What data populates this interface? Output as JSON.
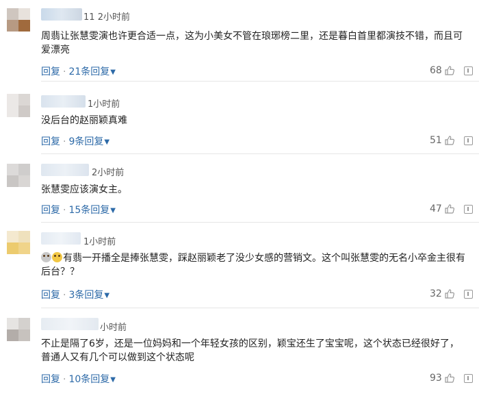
{
  "comments": [
    {
      "time": "2小时前",
      "name_suffix": "11",
      "text": "周翡让张慧雯演也许更合适一点，这为小美女不管在琅琊榜二里，还是暮白首里都演技不错，而且可爱漂亮",
      "reply_label": "回复",
      "replies_label": "21条回复",
      "likes": "68"
    },
    {
      "time": "1小时前",
      "name_suffix": "",
      "text": "没后台的赵丽颖真难",
      "reply_label": "回复",
      "replies_label": "9条回复",
      "likes": "51"
    },
    {
      "time": "2小时前",
      "name_suffix": "",
      "text": "张慧雯应该演女主。",
      "reply_label": "回复",
      "replies_label": "15条回复",
      "likes": "47"
    },
    {
      "time": "1小时前",
      "name_suffix": "",
      "text": "有翡一开播全是捧张慧雯，踩赵丽颖老了没少女感的营销文。这个叫张慧雯的无名小卒金主很有后台？？",
      "reply_label": "回复",
      "replies_label": "3条回复",
      "likes": "32"
    },
    {
      "time": "小时前",
      "name_suffix": "",
      "text": "不止是隔了6岁，还是一位妈妈和一个年轻女孩的区别，颖宝还生了宝宝呢，这个状态已经很好了，普通人又有几个可以做到这个状态呢",
      "reply_label": "回复",
      "replies_label": "10条回复",
      "likes": "93"
    }
  ],
  "separator": "·",
  "icons": {
    "like": "thumbs-up-icon",
    "report": "report-icon",
    "expand": "chevron-down-icon",
    "emoji": "face-emoji-icon"
  },
  "colors": {
    "link": "#2d6aa8",
    "text": "#222222",
    "meta": "#666666"
  }
}
